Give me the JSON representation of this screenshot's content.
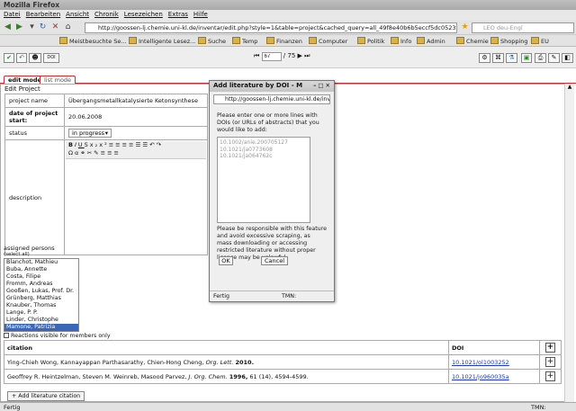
{
  "window": {
    "title": "Mozilla Firefox"
  },
  "menu": [
    "Datei",
    "Bearbeiten",
    "Ansicht",
    "Chronik",
    "Lesezeichen",
    "Extras",
    "Hilfe"
  ],
  "url": "http://goossen-lj.chemie.uni-kl.de/inventar/edit.php?style=1&table=project&cached_query=all_49f8e40b6b5eccf5dc0523fc99c21",
  "search_placeholder": "LEO deu-Engl",
  "bookmarks": [
    "Meistbesuchte Se...",
    "Intelligente Lesez...",
    "Suche",
    "Temp",
    "Finanzen",
    "Computer",
    "Politik",
    "Info",
    "Admin",
    "Chemie",
    "Shopping",
    "EU"
  ],
  "app_toolbar": {
    "page_value": "67",
    "page_total": "/ 75"
  },
  "tabs": {
    "edit": "edit mode",
    "list": "list mode"
  },
  "section_title": "Edit Project",
  "project": {
    "name_label": "project name",
    "name_value": "Übergangsmetallkatalysierte Ketonsynthese",
    "date_label": "date of project start:",
    "date_value": "20.06.2008",
    "status_label": "status",
    "status_value": "in progress",
    "desc_label": "description"
  },
  "assigned": {
    "label": "assigned persons",
    "select_all": "(select all)",
    "members": [
      "Blanchot, Mathieu",
      "Buba, Annette",
      "Costa, Filipe",
      "Fromm, Andreas",
      "Gooßen, Lukas, Prof. Dr.",
      "Grünberg, Matthias",
      "Knauber, Thomas",
      "Lange, P. P.",
      "Linder, Christophe",
      "Mamone, Patrizia"
    ],
    "selected_index": 9,
    "visible_label": "Reactions visible for members only"
  },
  "citations": {
    "header_citation": "citation",
    "header_doi": "DOI",
    "rows": [
      {
        "authors": "Ying-Chieh Wong, Kannayappan Parthasarathy, Chien-Hong Cheng,",
        "journal": "Org. Lett.",
        "year": "2010.",
        "rest": "",
        "doi": "10.1021/ol1003252"
      },
      {
        "authors": "Geoffrey R. Heintzelman, Steven M. Weinreb, Masood Parvez,",
        "journal": "J. Org. Chem.",
        "year": "1996,",
        "rest": "61 (14), 4594-4599.",
        "doi": "10.1021/jo960035a"
      }
    ],
    "add_button": "Add literature citation"
  },
  "dialog": {
    "title": "Add literature by DOI - M",
    "url": "http://goossen-lj.chemie.uni-kl.de/inv",
    "instructions": "Please enter one or more lines with DOIs (or URLs of abstracts) that you would like to add:",
    "sample_lines": [
      "10.1002/anie.200705127",
      "10.1021/ja0773608",
      "10.1021/ja064762c"
    ],
    "warning": "Please be responsible with this feature and avoid excessive scraping, as mass downloading or accessing restricted literature without proper licence may be unlawful.",
    "ok": "OK",
    "cancel": "Cancel",
    "status_left": "Fertig",
    "status_right": "TMN:"
  },
  "statusbar": {
    "left": "Fertig",
    "right": "TMN:"
  }
}
